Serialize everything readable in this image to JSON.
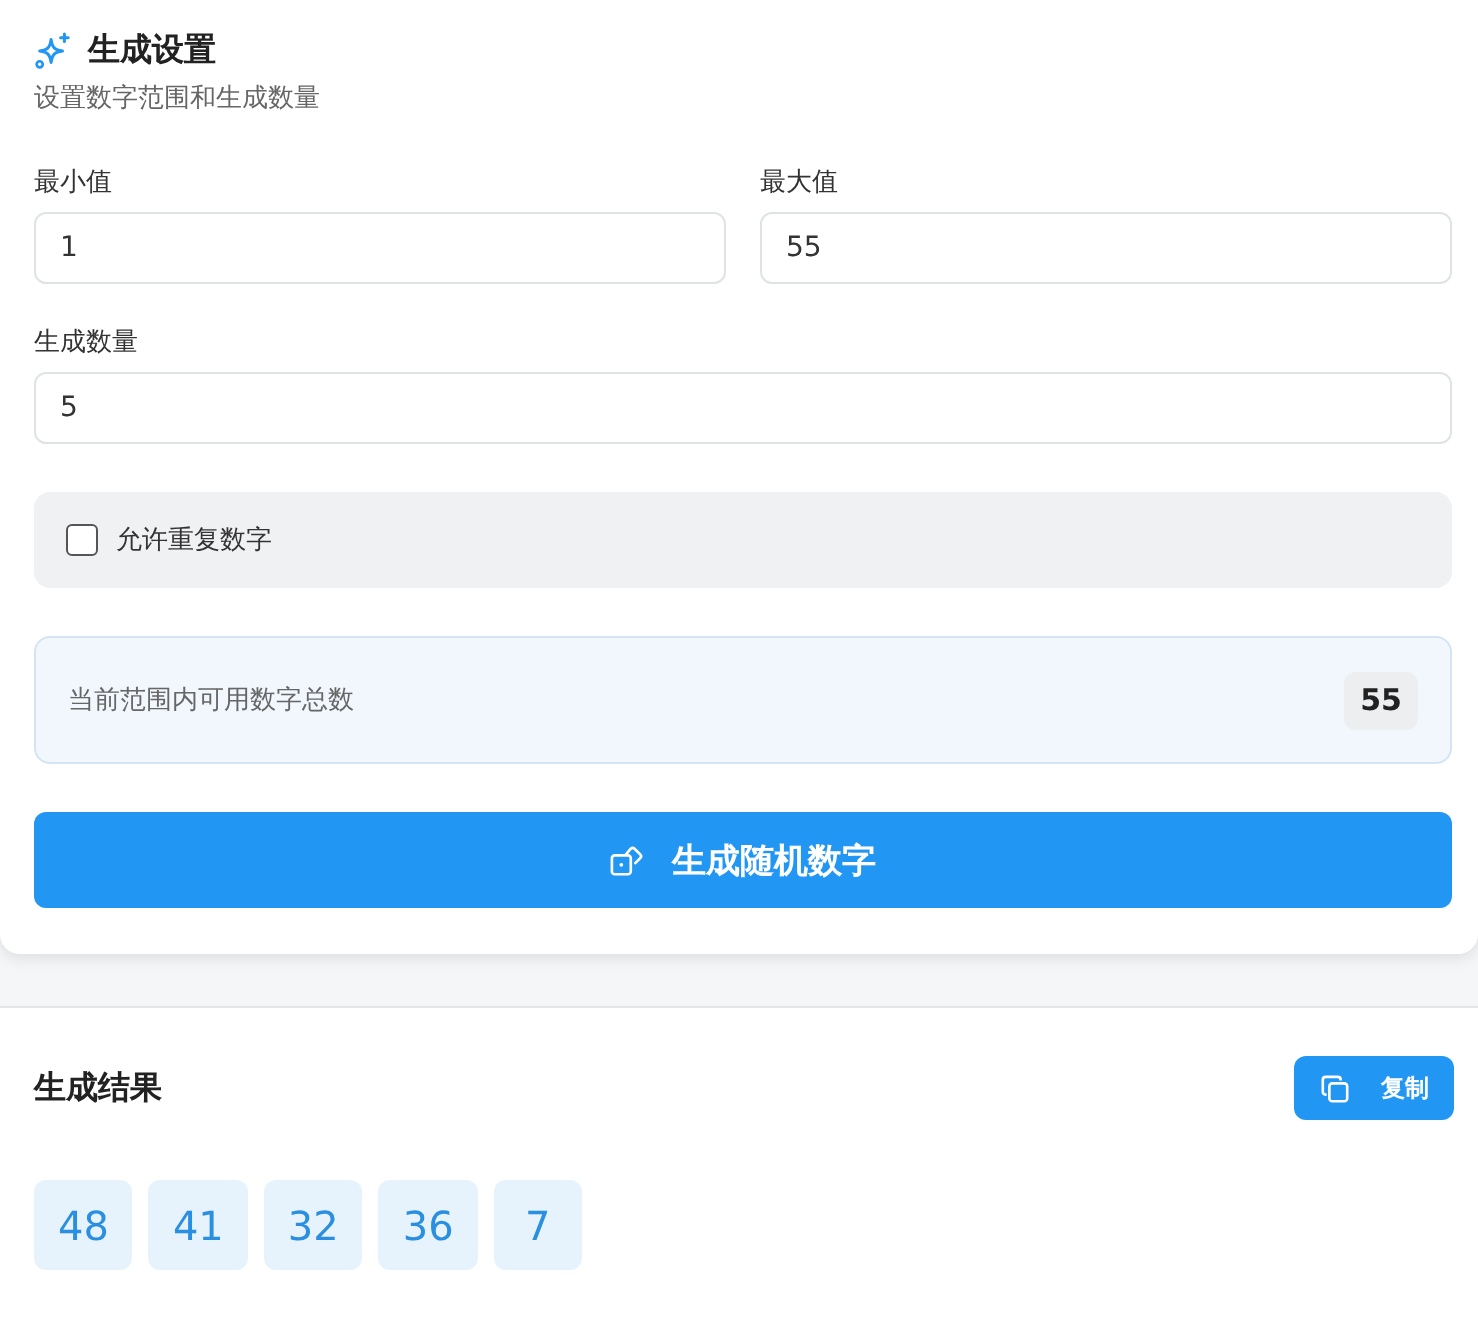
{
  "settings": {
    "title": "生成设置",
    "subtitle": "设置数字范围和生成数量",
    "range_fields": [
      {
        "label": "最小值",
        "value": "1"
      },
      {
        "label": "最大值",
        "value": "55"
      }
    ],
    "count_field": {
      "label": "生成数量",
      "value": "5"
    },
    "allow_duplicates": {
      "label": "允许重复数字",
      "checked": false
    },
    "available": {
      "label": "当前范围内可用数字总数",
      "count": "55"
    },
    "generate_button": "生成随机数字"
  },
  "results": {
    "title": "生成结果",
    "copy_button": "复制",
    "numbers": [
      "48",
      "41",
      "32",
      "36",
      "7"
    ]
  }
}
